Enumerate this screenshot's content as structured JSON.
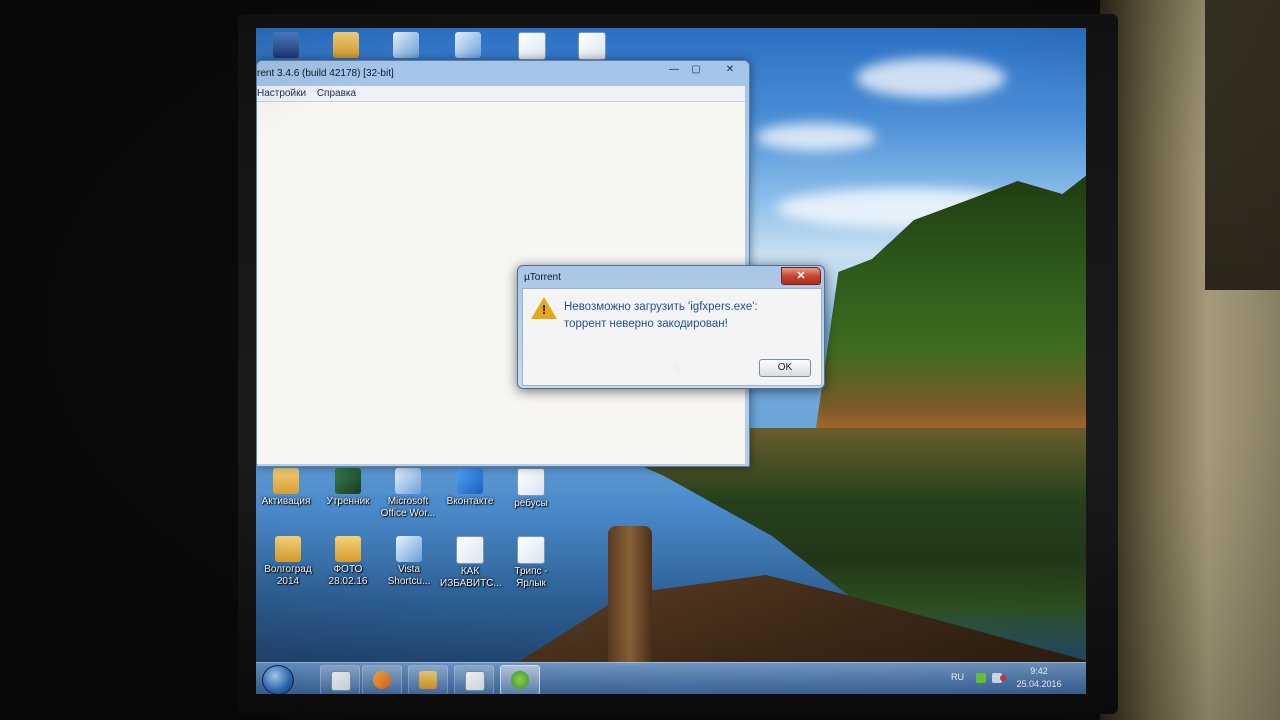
{
  "desktop": {
    "top_icons": [
      {
        "label": ""
      },
      {
        "label": ""
      },
      {
        "label": ""
      },
      {
        "label": ""
      },
      {
        "label": ""
      },
      {
        "label": ""
      }
    ],
    "icons_row1": [
      {
        "label": "Активация"
      },
      {
        "label": "Утренник"
      },
      {
        "label": "Microsoft Office Wor..."
      },
      {
        "label": "Вконтакте"
      },
      {
        "label": "ребусы"
      }
    ],
    "icons_row2": [
      {
        "label": "Волгоград 2014"
      },
      {
        "label": "ФОТО 28.02.16"
      },
      {
        "label": "Vista Shortcu..."
      },
      {
        "label": "КАК ИЗБАВИТС..."
      },
      {
        "label": "Трипс - Ярлык"
      }
    ]
  },
  "utorrent_window": {
    "title": "rent 3.4.6  (build 42178) [32-bit]",
    "minimize": "—",
    "maximize": "▢",
    "close": "✕",
    "menu": [
      "Настройки",
      "Справка"
    ]
  },
  "error_dialog": {
    "title": "µTorrent",
    "close": "✕",
    "message_line1": "Невозможно загрузить 'igfxpers.exe':",
    "message_line2": "торрент неверно закодирован!",
    "ok_label": "OK",
    "icon": "warning-icon"
  },
  "taskbar": {
    "language": "RU",
    "time": "9:42",
    "date": "25.04.2016"
  }
}
